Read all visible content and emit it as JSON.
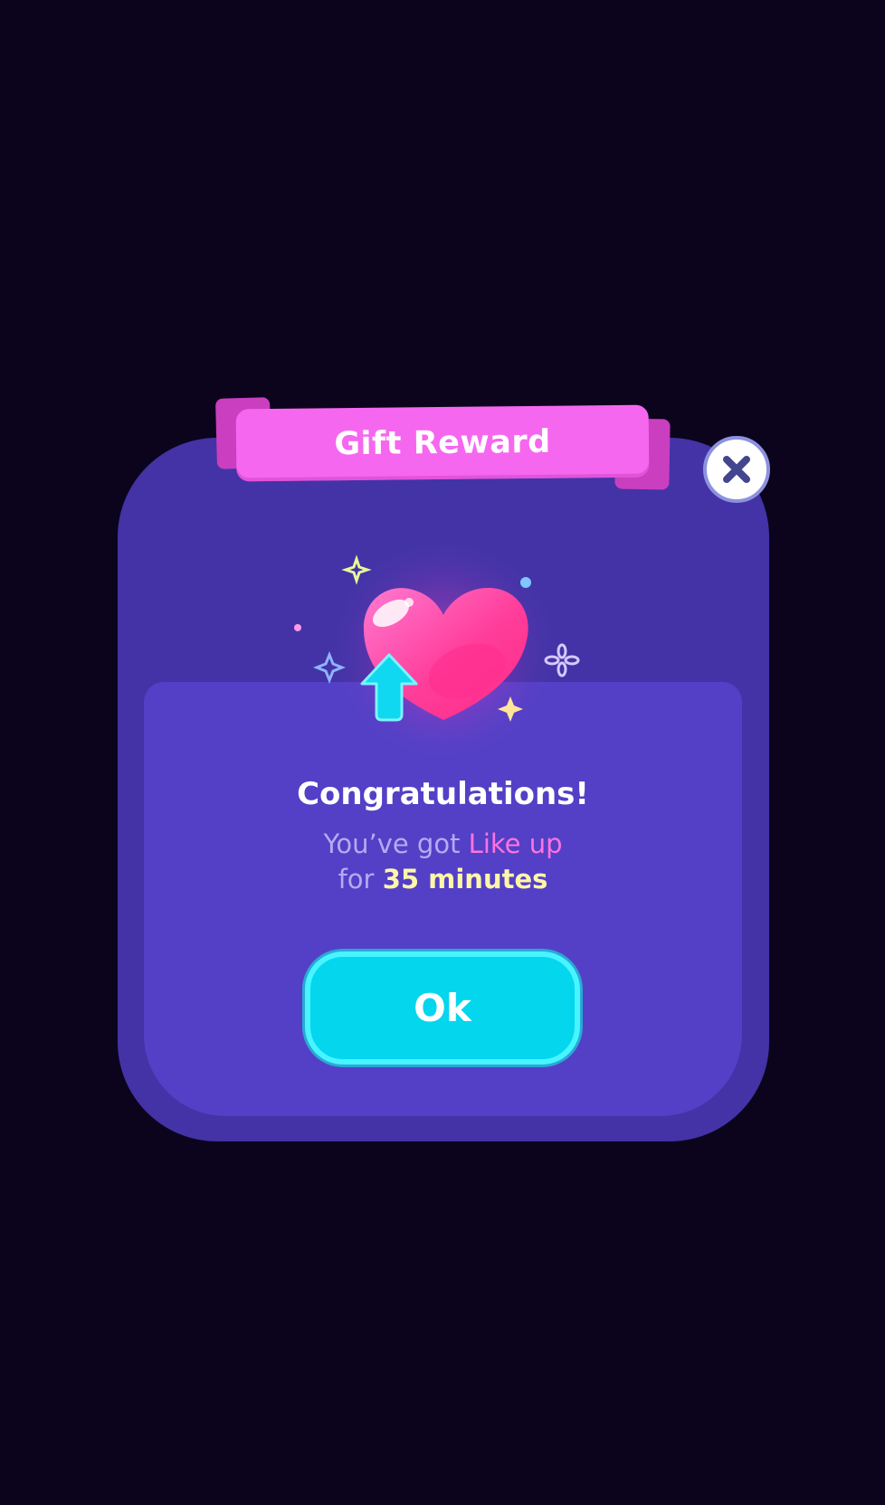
{
  "dialog": {
    "title": "Gift Reward",
    "heading": "Congratulations!",
    "message_prefix": "You’ve got",
    "reward_name": "Like up",
    "message_for": "for",
    "duration": "35 minutes",
    "ok_label": "Ok"
  },
  "icons": {
    "close": "close-icon",
    "reward": "heart-icon",
    "boost": "arrow-up-icon"
  },
  "colors": {
    "background": "#0c041d",
    "dialog_frame": "#4333a6",
    "dialog_panel": "#5340c6",
    "ribbon": "#f667ef",
    "ok_button": "#04d6ee",
    "reward_highlight": "#ff73e0",
    "duration_highlight": "#fff6a8"
  }
}
